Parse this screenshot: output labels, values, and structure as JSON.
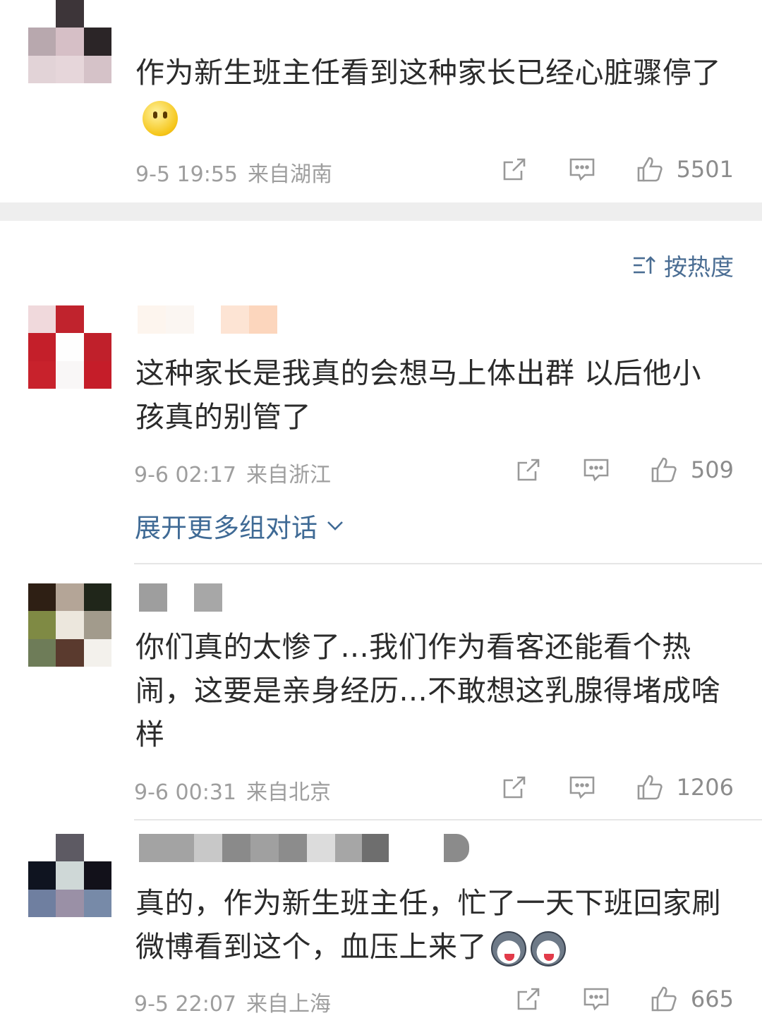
{
  "comments": [
    {
      "text": "作为新生班主任看到这种家长已经心脏骤停了",
      "emoji": "smile-emoji",
      "time": "9-5 19:55",
      "location": "来自湖南",
      "likes": "5501"
    },
    {
      "text": "这种家长是我真的会想马上体出群 以后他小孩真的别管了",
      "time": "9-6 02:17",
      "location": "来自浙江",
      "likes": "509",
      "expand_label": "展开更多组对话"
    },
    {
      "text": "你们真的太惨了...我们作为看客还能看个热闹，这要是亲身经历...不敢想这乳腺得堵成啥样",
      "time": "9-6 00:31",
      "location": "来自北京",
      "likes": "1206"
    },
    {
      "text": "真的，作为新生班主任，忙了一天下班回家刷微博看到这个，血压上来了",
      "emoji": "husky-emoji",
      "time": "9-5 22:07",
      "location": "来自上海",
      "likes": "665"
    }
  ],
  "sort_label": "按热度",
  "icons": [
    "share-icon",
    "comment-icon",
    "like-icon",
    "sort-icon",
    "chevron-down-icon"
  ],
  "colors": {
    "link": "#3f6a95",
    "meta": "#9e9e9e",
    "separator": "#eeeeee"
  }
}
